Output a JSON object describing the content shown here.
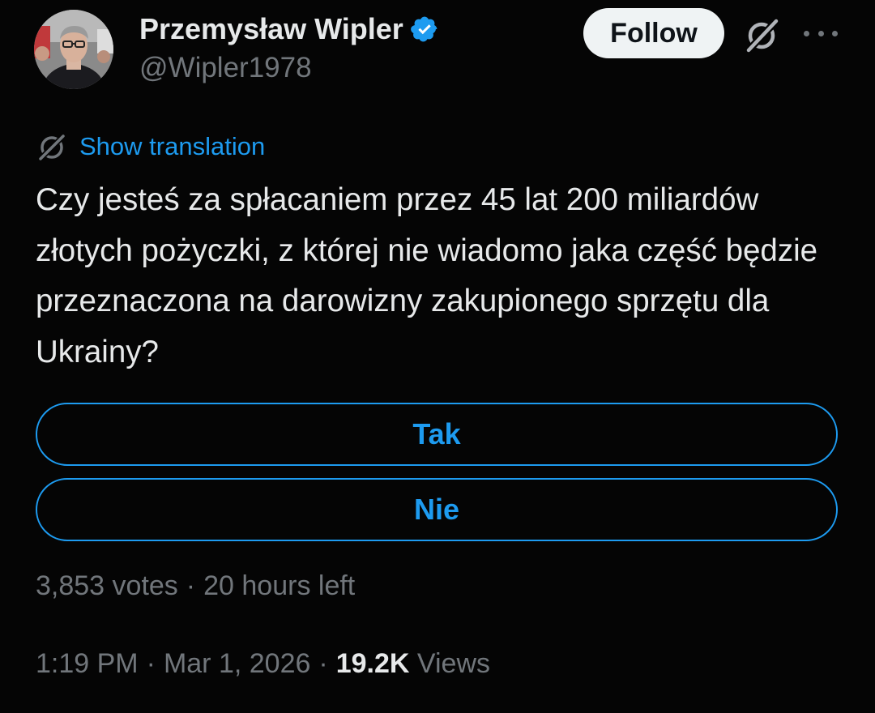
{
  "author": {
    "display_name": "Przemysław Wipler",
    "handle": "@Wipler1978",
    "verified": true,
    "verified_color": "#1d9bf0"
  },
  "actions": {
    "follow_label": "Follow",
    "grok_icon": "grok-icon",
    "more_icon": "more-icon"
  },
  "translation": {
    "label": "Show translation",
    "icon": "translate-icon"
  },
  "tweet": {
    "text": "Czy jesteś za spłacaniem przez 45 lat 200 miliardów złotych pożyczki, z której nie wiadomo jaka część będzie przeznaczona na darowizny zakupionego sprzętu dla Ukrainy?"
  },
  "poll": {
    "options": [
      {
        "label": "Tak"
      },
      {
        "label": "Nie"
      }
    ],
    "votes": "3,853 votes",
    "separator": "·",
    "time_left": "20 hours left"
  },
  "meta": {
    "time": "1:19 PM",
    "separator": "·",
    "date": "Mar 1, 2026",
    "views_count": "19.2K",
    "views_label": "Views"
  },
  "colors": {
    "background": "#000000",
    "accent": "#1d9bf0",
    "secondary_text": "#71767b",
    "primary_text": "#e7e9ea"
  }
}
